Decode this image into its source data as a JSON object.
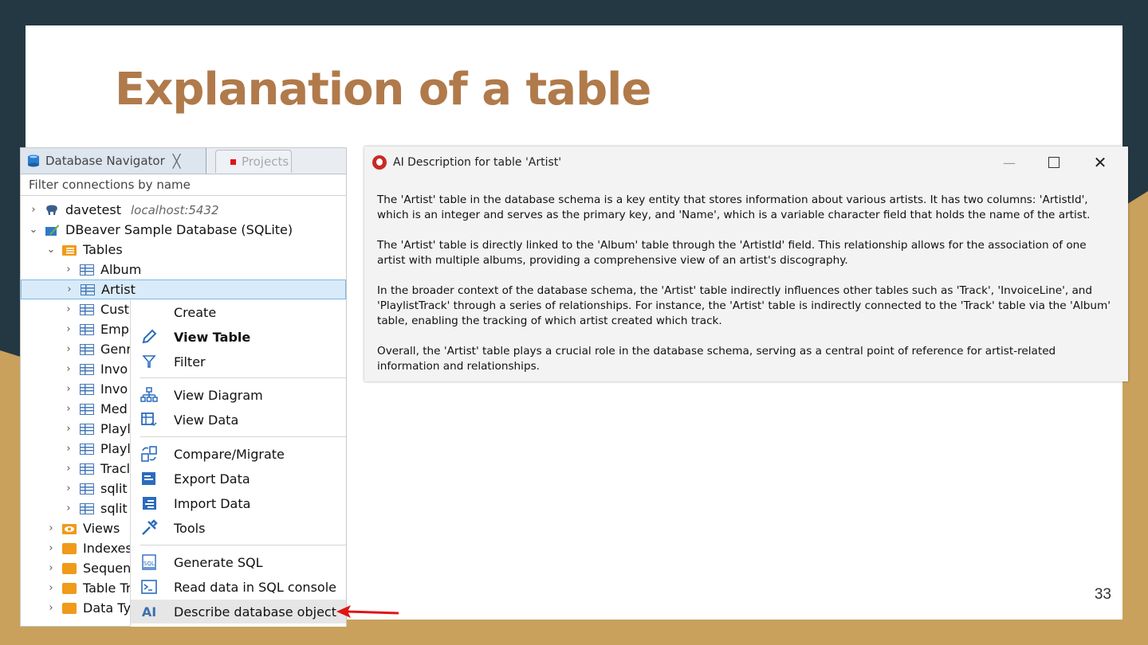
{
  "slide": {
    "title": "Explanation of a table",
    "page_number": "33"
  },
  "navigator": {
    "tab_active": "Database Navigator",
    "tab_close": "╳",
    "tab_other": "Projects",
    "filter_placeholder": "Filter connections by name",
    "tree": [
      {
        "label": "davetest",
        "detail": "localhost:5432",
        "icon": "postgres-elephant-icon",
        "expanded": false
      },
      {
        "label": "DBeaver Sample Database (SQLite)",
        "icon": "sqlite-db-icon",
        "expanded": true
      },
      {
        "label": "Tables",
        "icon": "tables-folder-icon",
        "expanded": true
      },
      {
        "label": "Album",
        "icon": "table-icon"
      },
      {
        "label": "Artist",
        "icon": "table-icon",
        "selected": true
      },
      {
        "label": "Cust",
        "icon": "table-icon"
      },
      {
        "label": "Emp",
        "icon": "table-icon"
      },
      {
        "label": "Genr",
        "icon": "table-icon"
      },
      {
        "label": "Invo",
        "icon": "table-icon"
      },
      {
        "label": "Invo",
        "icon": "table-icon"
      },
      {
        "label": "Med",
        "icon": "table-icon"
      },
      {
        "label": "Playl",
        "icon": "table-icon"
      },
      {
        "label": "Playl",
        "icon": "table-icon"
      },
      {
        "label": "Tracl",
        "icon": "table-icon"
      },
      {
        "label": "sqlit",
        "icon": "table-icon"
      },
      {
        "label": "sqlit",
        "icon": "table-icon"
      },
      {
        "label": "Views",
        "icon": "views-folder-icon"
      },
      {
        "label": "Indexes",
        "icon": "folder-icon"
      },
      {
        "label": "Sequen",
        "icon": "folder-icon"
      },
      {
        "label": "Table Tr",
        "icon": "folder-icon"
      },
      {
        "label": "Data Ty",
        "icon": "folder-icon"
      }
    ]
  },
  "context_menu": {
    "items": [
      {
        "label": "Create",
        "icon": ""
      },
      {
        "label": "View Table",
        "icon": "pencil-icon",
        "bold": true
      },
      {
        "label": "Filter",
        "icon": "filter-icon"
      },
      {
        "label": "View Diagram",
        "icon": "diagram-icon"
      },
      {
        "label": "View Data",
        "icon": "view-data-icon"
      },
      {
        "label": "Compare/Migrate",
        "icon": "compare-icon"
      },
      {
        "label": "Export Data",
        "icon": "export-icon"
      },
      {
        "label": "Import Data",
        "icon": "import-icon"
      },
      {
        "label": "Tools",
        "icon": "tools-icon"
      },
      {
        "label": "Generate SQL",
        "icon": "sql-icon"
      },
      {
        "label": "Read data in SQL console",
        "icon": "console-icon"
      },
      {
        "label": "Describe database object",
        "icon": "ai-icon",
        "icon_text": "AI"
      }
    ]
  },
  "ai_dialog": {
    "title": "AI Description for table 'Artist'",
    "paragraphs": [
      "The 'Artist' table in the database schema is a key entity that stores information about various artists. It has two columns: 'ArtistId', which is an integer and serves as the primary key, and 'Name', which is a variable character field that holds the name of the artist.",
      "The 'Artist' table is directly linked to the 'Album' table through the 'ArtistId' field. This relationship allows for the association of one artist with multiple albums, providing a comprehensive view of an artist's discography.",
      "In the broader context of the database schema, the 'Artist' table indirectly influences other tables such as 'Track', 'InvoiceLine', and 'PlaylistTrack' through a series of relationships. For instance, the 'Artist' table is indirectly connected to the 'Track' table via the 'Album' table, enabling the tracking of which artist created which track.",
      "Overall, the 'Artist' table plays a crucial role in the database schema, serving as a central point of reference for artist-related information and relationships."
    ],
    "controls": {
      "minimize": "—",
      "close": "✕"
    }
  },
  "colors": {
    "title": "#b07a4b",
    "background_dark": "#243843",
    "background_gold": "#c9a15c",
    "selection": "#d9ebf9",
    "arrow": "#e01515"
  }
}
